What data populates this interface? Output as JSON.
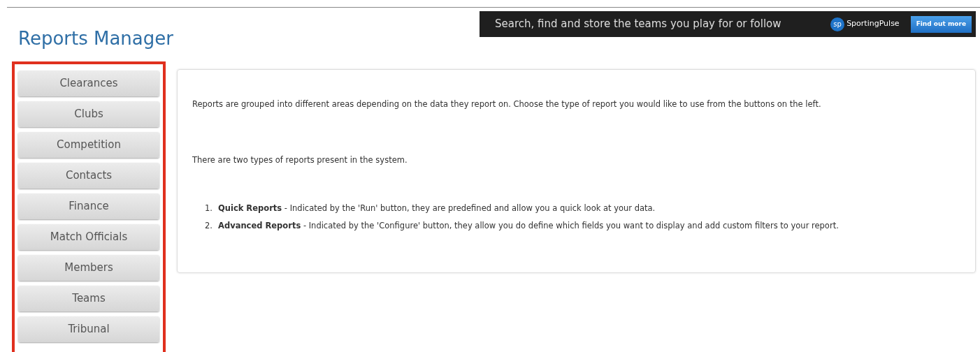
{
  "banner": {
    "text": "Search, find and store the teams you play for or follow",
    "logo_mark": "sp",
    "logo_text": "SportingPulse",
    "button": "Find out more"
  },
  "title": "Reports Manager",
  "sidebar": {
    "highlighted": true,
    "items": [
      {
        "label": "Clearances"
      },
      {
        "label": "Clubs"
      },
      {
        "label": "Competition"
      },
      {
        "label": "Contacts"
      },
      {
        "label": "Finance"
      },
      {
        "label": "Match Officials"
      },
      {
        "label": "Members"
      },
      {
        "label": "Teams"
      },
      {
        "label": "Tribunal"
      }
    ]
  },
  "content": {
    "paragraphs": [
      "Reports are grouped into different areas depending on the data they report on. Choose the type of report you would like to use from the buttons on the left.",
      "There are two types of reports present in the system."
    ],
    "list": [
      {
        "number": "1.",
        "text": "**Quick Reports** - Indicated by the 'Run' button, they are predefined and allow you a quick look at your data."
      },
      {
        "number": "2.",
        "text": "**Advanced Reports** - Indicated by the 'Configure' button, they allow you do define which fields you want to display and add custom filters to your report."
      }
    ]
  }
}
